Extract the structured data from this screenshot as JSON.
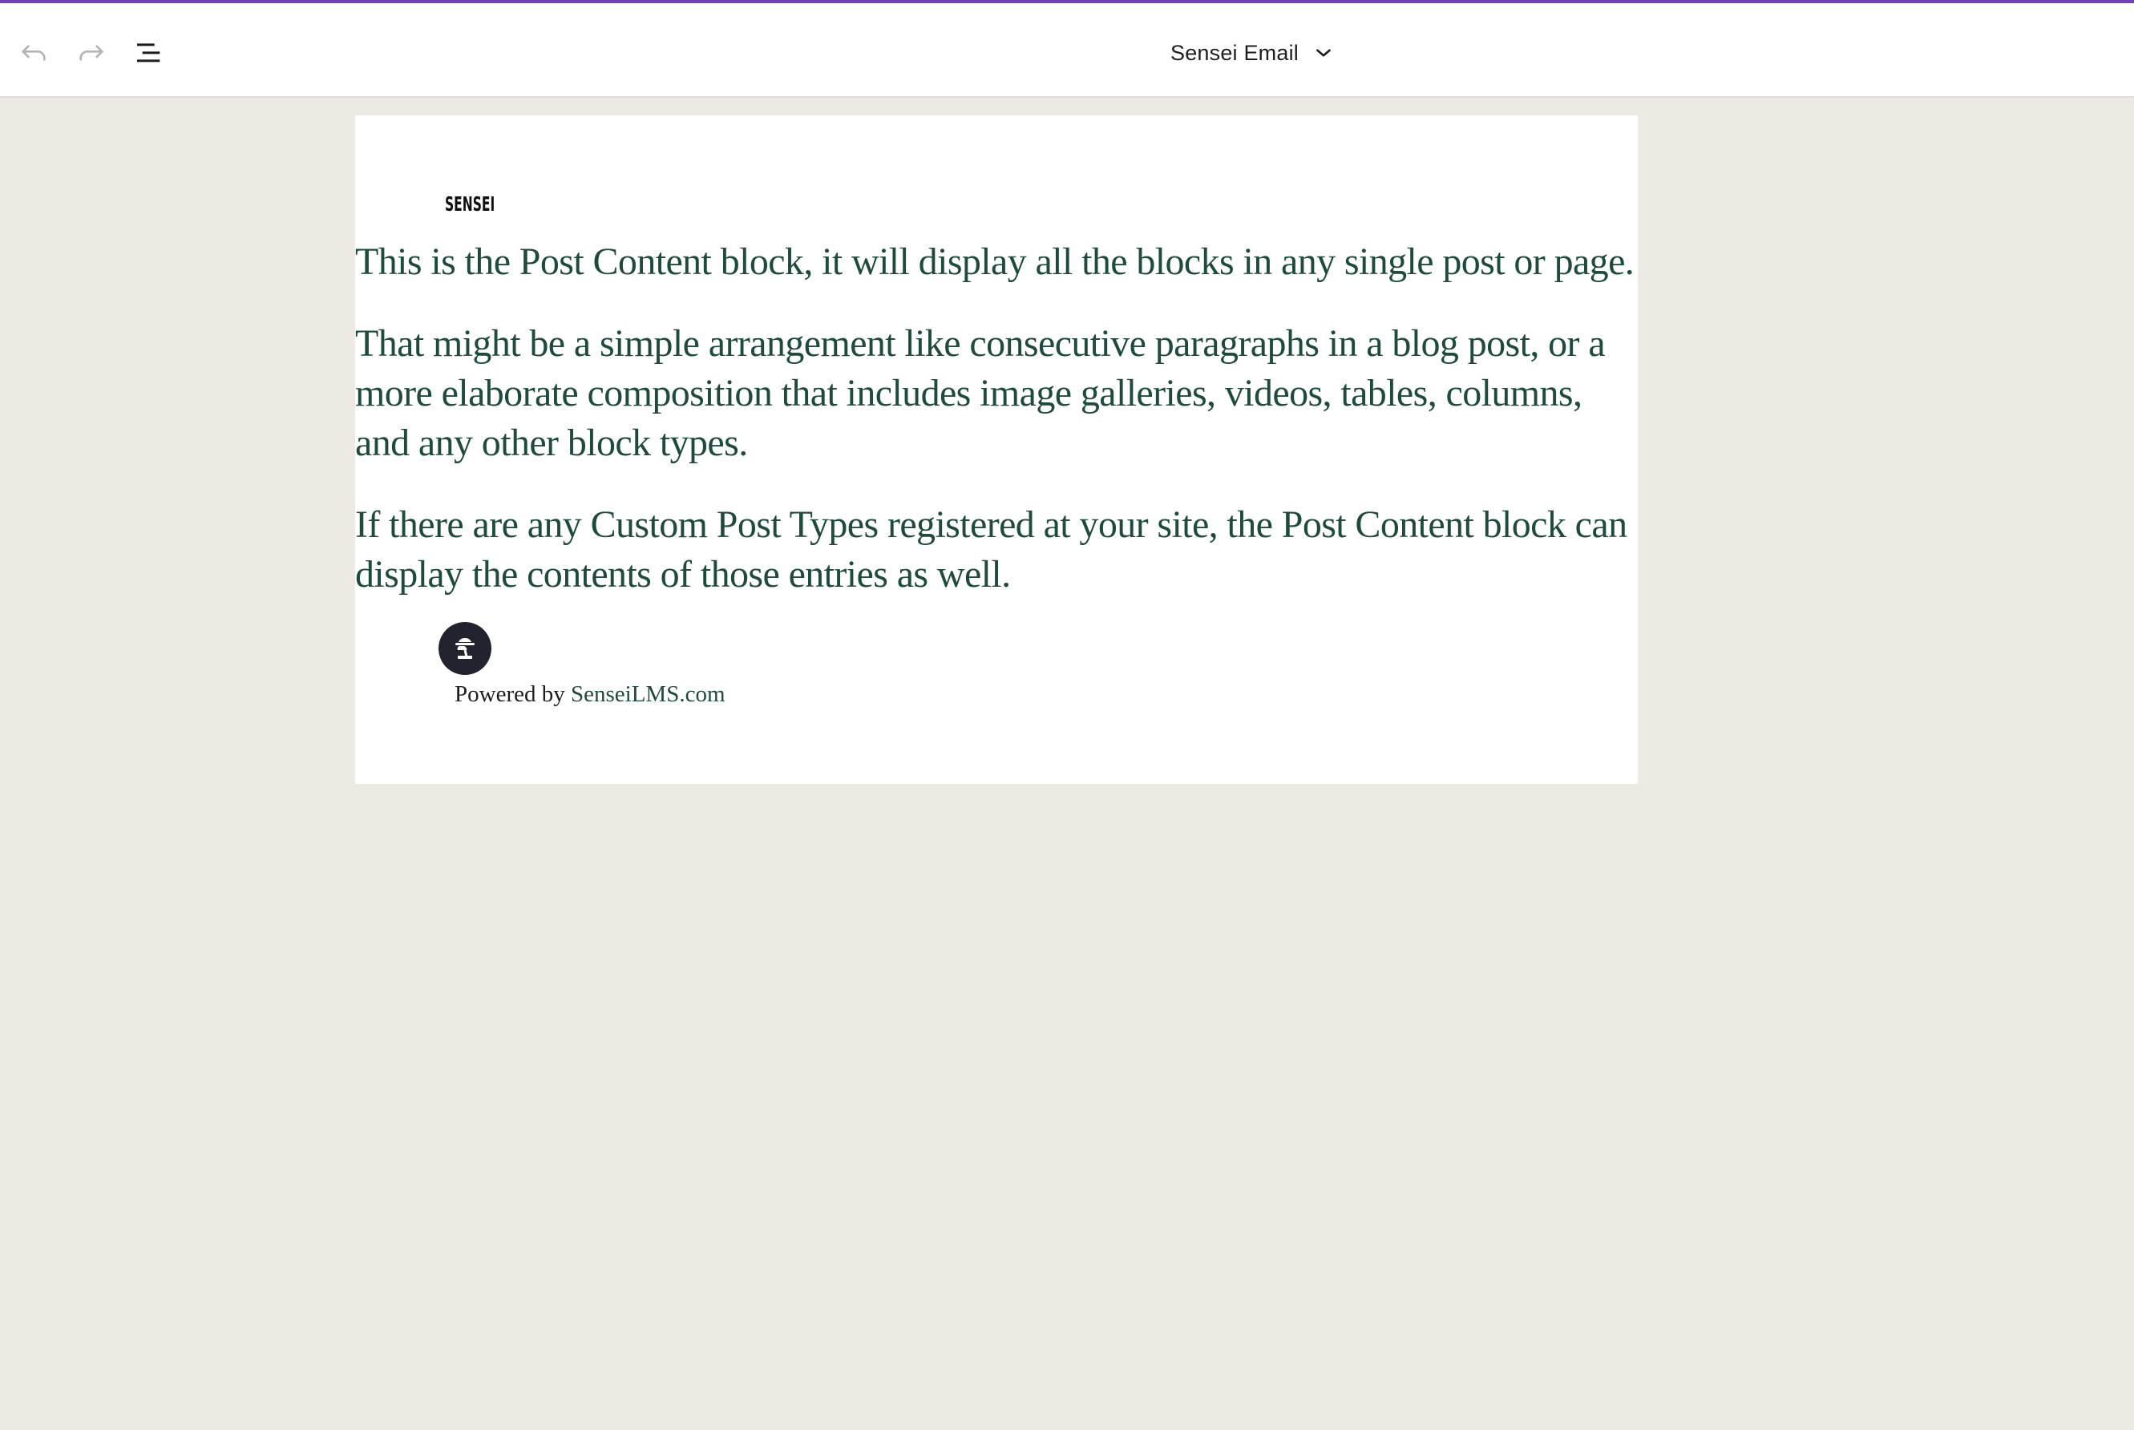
{
  "toolbar": {
    "undo_icon": "undo-icon",
    "redo_icon": "redo-icon",
    "outline_icon": "list-view-icon",
    "document_title": "Sensei Email",
    "title_dropdown_icon": "chevron-down-icon"
  },
  "colors": {
    "accent_bar": "#6e3fb5",
    "text_green": "#1f4a3c",
    "canvas_bg": "#edeae4"
  },
  "email": {
    "logo_text": "SENSEI",
    "paragraphs": [
      "This is the Post Content block, it will display all the blocks in any single post or page.",
      "That might be a simple arrangement like consecutive paragraphs in a blog post, or a more elaborate composition that includes image galleries, videos, tables, columns, and any other block types.",
      "If there are any Custom Post Types registered at your site, the Post Content block can display the contents of those entries as well."
    ],
    "footer": {
      "badge_icon": "bonsai-tree-icon",
      "powered_by": "Powered by",
      "link_text": "SenseiLMS.com"
    }
  }
}
